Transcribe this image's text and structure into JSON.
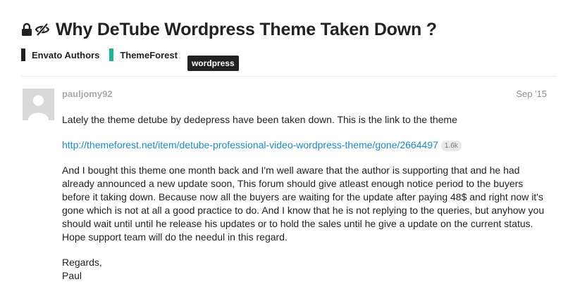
{
  "topic": {
    "title": "Why DeTube Wordpress Theme Taken Down ?",
    "icons": [
      "lock-icon",
      "eye-slash-icon"
    ]
  },
  "categories": [
    {
      "label": "Envato Authors",
      "color": "#222222"
    },
    {
      "label": "ThemeForest",
      "color": "#1bb495"
    }
  ],
  "tags": [
    {
      "label": "wordpress"
    }
  ],
  "post": {
    "username": "pauljomy92",
    "date": "Sep '15",
    "paragraph1": "Lately the theme detube by dedepress have been taken down. This is the link to the theme",
    "link": "http://themeforest.net/item/detube-professional-video-wordpress-theme/gone/2664497",
    "link_clicks": "1.6k",
    "paragraph2": "And I bought this theme one month back and I'm well aware that the author is supporting that and he had already announced a new update soon, This forum should give atleast enough notice period to the buyers before it taking down. Because now all the buyers are waiting for the update after paying 48$ and right now it's gone which is not at all a good practice to do. And I know that he is not replying to the queries, but anyhow you should wait until until he release his updates or to hold the sales until he give a update on the current status. Hope support team will do the needul in this regard.",
    "signoff_line1": "Regards,",
    "signoff_line2": "Paul"
  },
  "colors": {
    "link": "#1d8ac2",
    "category_authors": "#222222",
    "category_themeforest": "#1bb495",
    "tag_background": "#222222",
    "muted_text": "#a9a9a9"
  }
}
